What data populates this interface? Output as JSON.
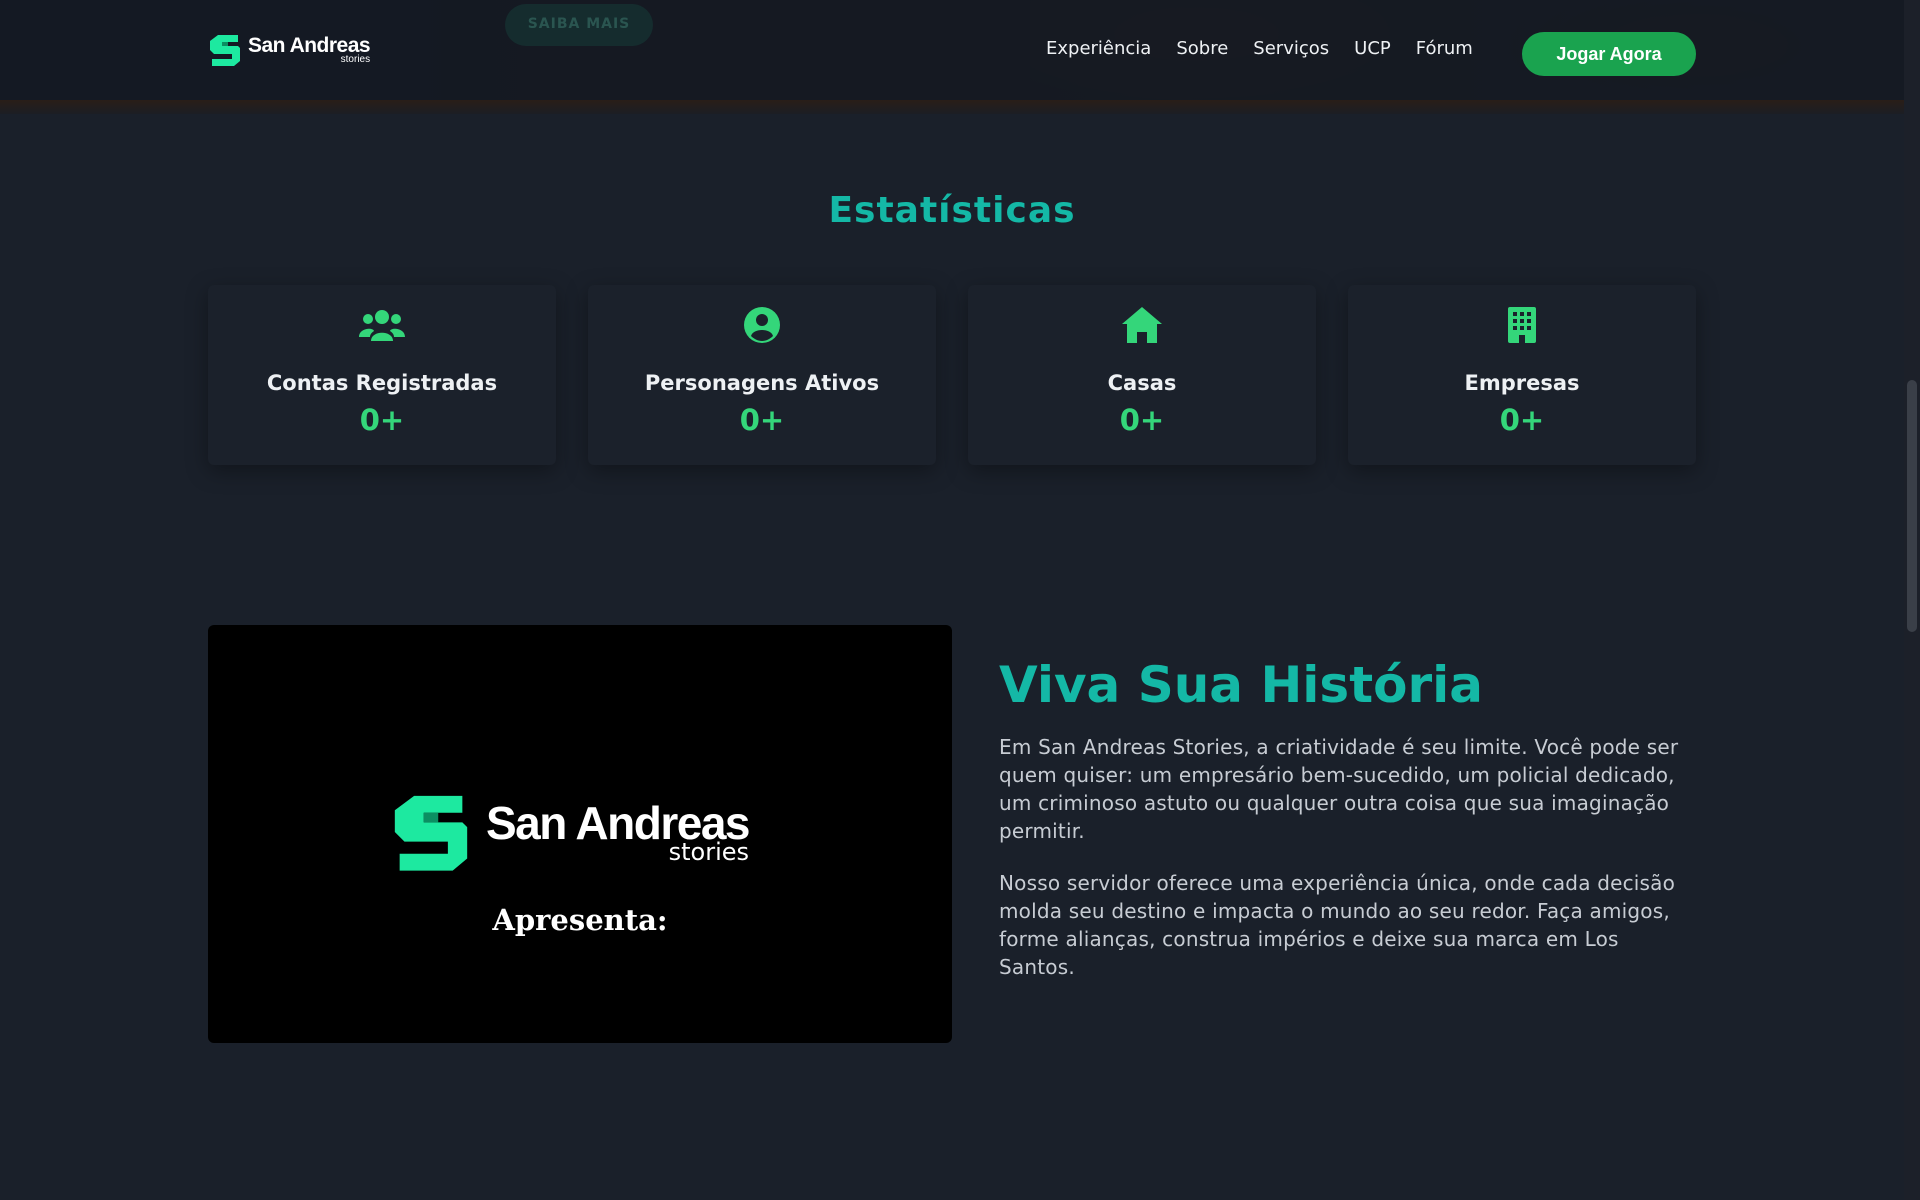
{
  "colors": {
    "accent": "#14b8a6",
    "green": "#34d67a",
    "button": "#1aa34f",
    "background": "#1a202a"
  },
  "hero": {
    "ghost_button_label": "SAIBA MAIS"
  },
  "navbar": {
    "logo": {
      "name": "San Andreas",
      "tagline": "stories"
    },
    "links": [
      {
        "label": "Experiência"
      },
      {
        "label": "Sobre"
      },
      {
        "label": "Serviços"
      },
      {
        "label": "UCP"
      },
      {
        "label": "Fórum"
      }
    ],
    "cta_label": "Jogar Agora"
  },
  "stats": {
    "title": "Estatísticas",
    "items": [
      {
        "icon": "users-icon",
        "label": "Contas Registradas",
        "value": "0+"
      },
      {
        "icon": "user-circle-icon",
        "label": "Personagens Ativos",
        "value": "0+"
      },
      {
        "icon": "home-icon",
        "label": "Casas",
        "value": "0+"
      },
      {
        "icon": "building-icon",
        "label": "Empresas",
        "value": "0+"
      }
    ]
  },
  "video": {
    "logo_name": "San Andreas",
    "logo_tagline": "stories",
    "caption": "Apresenta:"
  },
  "story": {
    "title": "Viva Sua História",
    "paragraphs": [
      "Em San Andreas Stories, a criatividade é seu limite. Você pode ser quem quiser: um empresário bem-sucedido, um policial dedicado, um criminoso astuto ou qualquer outra coisa que sua imaginação permitir.",
      "Nosso servidor oferece uma experiência única, onde cada decisão molda seu destino e impacta o mundo ao seu redor. Faça amigos, forme alianças, construa impérios e deixe sua marca em Los Santos."
    ]
  }
}
